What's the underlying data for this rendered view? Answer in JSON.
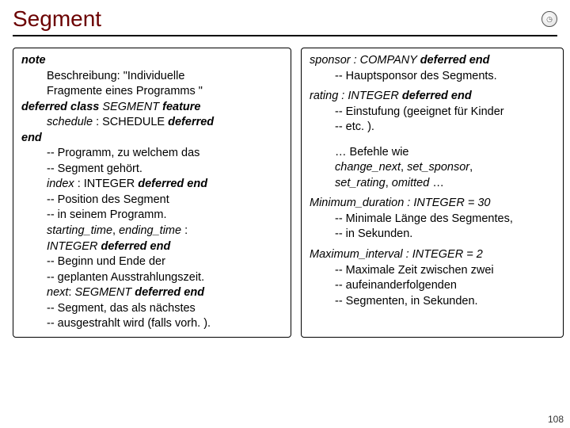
{
  "title": "Segment",
  "pagenum": "108",
  "left": {
    "note": "note",
    "beschr1": "Beschreibung: \"Individuelle",
    "beschr2": "Fragmente eines Programms \"",
    "defclass1": "deferred class",
    "defclass2": "SEGMENT",
    "defclass3": "feature",
    "sched1": "schedule",
    "sched2": " : SCHEDULE ",
    "sched3": "deferred",
    "end": "end",
    "c1a": "-- Programm, zu welchem das",
    "c1b": " -- Segment gehört.",
    "idx1": "index",
    "idx2": " : INTEGER ",
    "idx3": "deferred end",
    "c2a": "-- Position des Segment",
    "c2b": "-- in seinem Programm.",
    "st1": "starting_time",
    "st2": ", ",
    "st3": "ending_time",
    "st4": " :",
    "st5": "INTEGER",
    "st6": "deferred end",
    "c3a": "-- Beginn und Ende der",
    "c3b": "-- geplanten Ausstrahlungszeit.",
    "nx1": "next",
    "nx2": ": SEGMENT",
    "nx3": "deferred end",
    "c4a": "-- Segment, das als nächstes",
    "c4b": "-- ausgestrahlt wird (falls vorh. )."
  },
  "right": {
    "sp1": "sponsor",
    "sp2": " : COMPANY ",
    "sp3": "deferred end",
    "spc": "-- Hauptsponsor des Segments.",
    "rt1": "rating",
    "rt2": " : INTEGER ",
    "rt3": "deferred end",
    "rtc1": "-- Einstufung (geeignet für Kinder",
    "rtc2": "-- etc. ).",
    "bf1": "… Befehle wie",
    "bf2a": "change_next",
    "bf2b": ", ",
    "bf2c": "set_sponsor",
    "bf2d": ",",
    "bf3a": "set_rating",
    "bf3b": ", ",
    "bf3c": "omitted",
    "bf3d": " …",
    "md1": "Minimum_duration",
    "md2": " : INTEGER = 30",
    "mdc1": "-- Minimale Länge des Segmentes,",
    "mdc2": "-- in Sekunden.",
    "mx1": "Maximum_interval",
    "mx2": " : INTEGER = 2",
    "mxc1": "-- Maximale Zeit zwischen zwei",
    "mxc2": "-- aufeinanderfolgenden",
    "mxc3": "-- Segmenten, in Sekunden."
  }
}
